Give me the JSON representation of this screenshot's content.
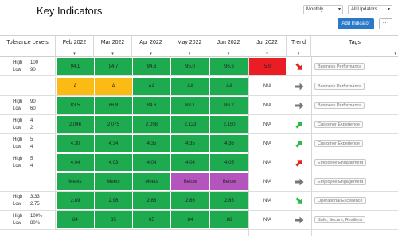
{
  "header": {
    "title": "Key Indicators",
    "period_select": "Monthly",
    "updators_select": "All Updators",
    "add_button": "Add Indicator",
    "more_button": "···"
  },
  "columns": {
    "tolerance": "Tolerance Levels",
    "months": [
      "Feb 2022",
      "Mar 2022",
      "Apr 2022",
      "May 2022",
      "Jun 2022",
      "Jul 2022"
    ],
    "trend": "Trend",
    "tags": "Tags"
  },
  "colors": {
    "green": "#1eaa4e",
    "amber": "#fbba14",
    "purple": "#b455bd",
    "red": "#ea1c24",
    "arrow_green": "#2eb84b",
    "arrow_red": "#e02424",
    "arrow_gray": "#777777",
    "accent": "#2b78c8"
  },
  "rows": [
    {
      "tol": {
        "high_label": "High",
        "high": "100",
        "low_label": "Low",
        "low": "90"
      },
      "values": [
        "94.1",
        "94.7",
        "94.6",
        "95.0",
        "96.6",
        "5.0"
      ],
      "colors": [
        "green",
        "green",
        "green",
        "green",
        "green",
        "red"
      ],
      "jul_na": "",
      "trend": "down-red",
      "tag": "Business Performance"
    },
    {
      "tol": {
        "high_label": "",
        "high": "",
        "low_label": "",
        "low": ""
      },
      "values": [
        "A",
        "A",
        "AA",
        "AA",
        "AA"
      ],
      "colors": [
        "amber",
        "amber",
        "green",
        "green",
        "green"
      ],
      "jul_na": "N/A",
      "trend": "right-gray",
      "tag": "Business Performance"
    },
    {
      "tol": {
        "high_label": "High",
        "high": "90",
        "low_label": "Low",
        "low": "60"
      },
      "values": [
        "83.5",
        "86.8",
        "84.6",
        "88.1",
        "88.2"
      ],
      "colors": [
        "green",
        "green",
        "green",
        "green",
        "green"
      ],
      "jul_na": "N/A",
      "trend": "right-gray",
      "tag": "Business Performance"
    },
    {
      "tol": {
        "high_label": "High",
        "high": "4",
        "low_label": "Low",
        "low": "2"
      },
      "values": [
        "2.046",
        "2.075",
        "2.098",
        "2.123",
        "2.150"
      ],
      "colors": [
        "green",
        "green",
        "green",
        "green",
        "green"
      ],
      "jul_na": "N/A",
      "trend": "up-green",
      "tag": "Customer Experience"
    },
    {
      "tol": {
        "high_label": "High",
        "high": "5",
        "low_label": "Low",
        "low": "4"
      },
      "values": [
        "4.30",
        "4.34",
        "4.35",
        "4.35",
        "4.36"
      ],
      "colors": [
        "green",
        "green",
        "green",
        "green",
        "green"
      ],
      "jul_na": "N/A",
      "trend": "up-green",
      "tag": "Customer Experience"
    },
    {
      "tol": {
        "high_label": "High",
        "high": "5",
        "low_label": "Low",
        "low": "4"
      },
      "values": [
        "4.04",
        "4.03",
        "4.04",
        "4.04",
        "4.05"
      ],
      "colors": [
        "green",
        "green",
        "green",
        "green",
        "green"
      ],
      "jul_na": "N/A",
      "trend": "up-red",
      "tag": "Employee Engagement"
    },
    {
      "tol": {
        "high_label": "",
        "high": "",
        "low_label": "",
        "low": ""
      },
      "values": [
        "Meets",
        "Meets",
        "Meets",
        "Below",
        "Below"
      ],
      "colors": [
        "green",
        "green",
        "green",
        "purple",
        "purple"
      ],
      "jul_na": "N/A",
      "trend": "right-gray",
      "tag": "Employee Engagement"
    },
    {
      "tol": {
        "high_label": "High",
        "high": "3.33",
        "low_label": "Low",
        "low": "2.75"
      },
      "values": [
        "2.89",
        "2.96",
        "2.88",
        "2.86",
        "2.85"
      ],
      "colors": [
        "green",
        "green",
        "green",
        "green",
        "green"
      ],
      "jul_na": "N/A",
      "trend": "down-green",
      "tag": "Operational Excellence"
    },
    {
      "tol": {
        "high_label": "High",
        "high": "100%",
        "low_label": "Low",
        "low": "80%"
      },
      "values": [
        "84",
        "85",
        "85",
        "84",
        "86"
      ],
      "colors": [
        "green",
        "green",
        "green",
        "green",
        "green"
      ],
      "jul_na": "N/A",
      "trend": "right-gray",
      "tag": "Safe, Secure, Resilient"
    }
  ]
}
